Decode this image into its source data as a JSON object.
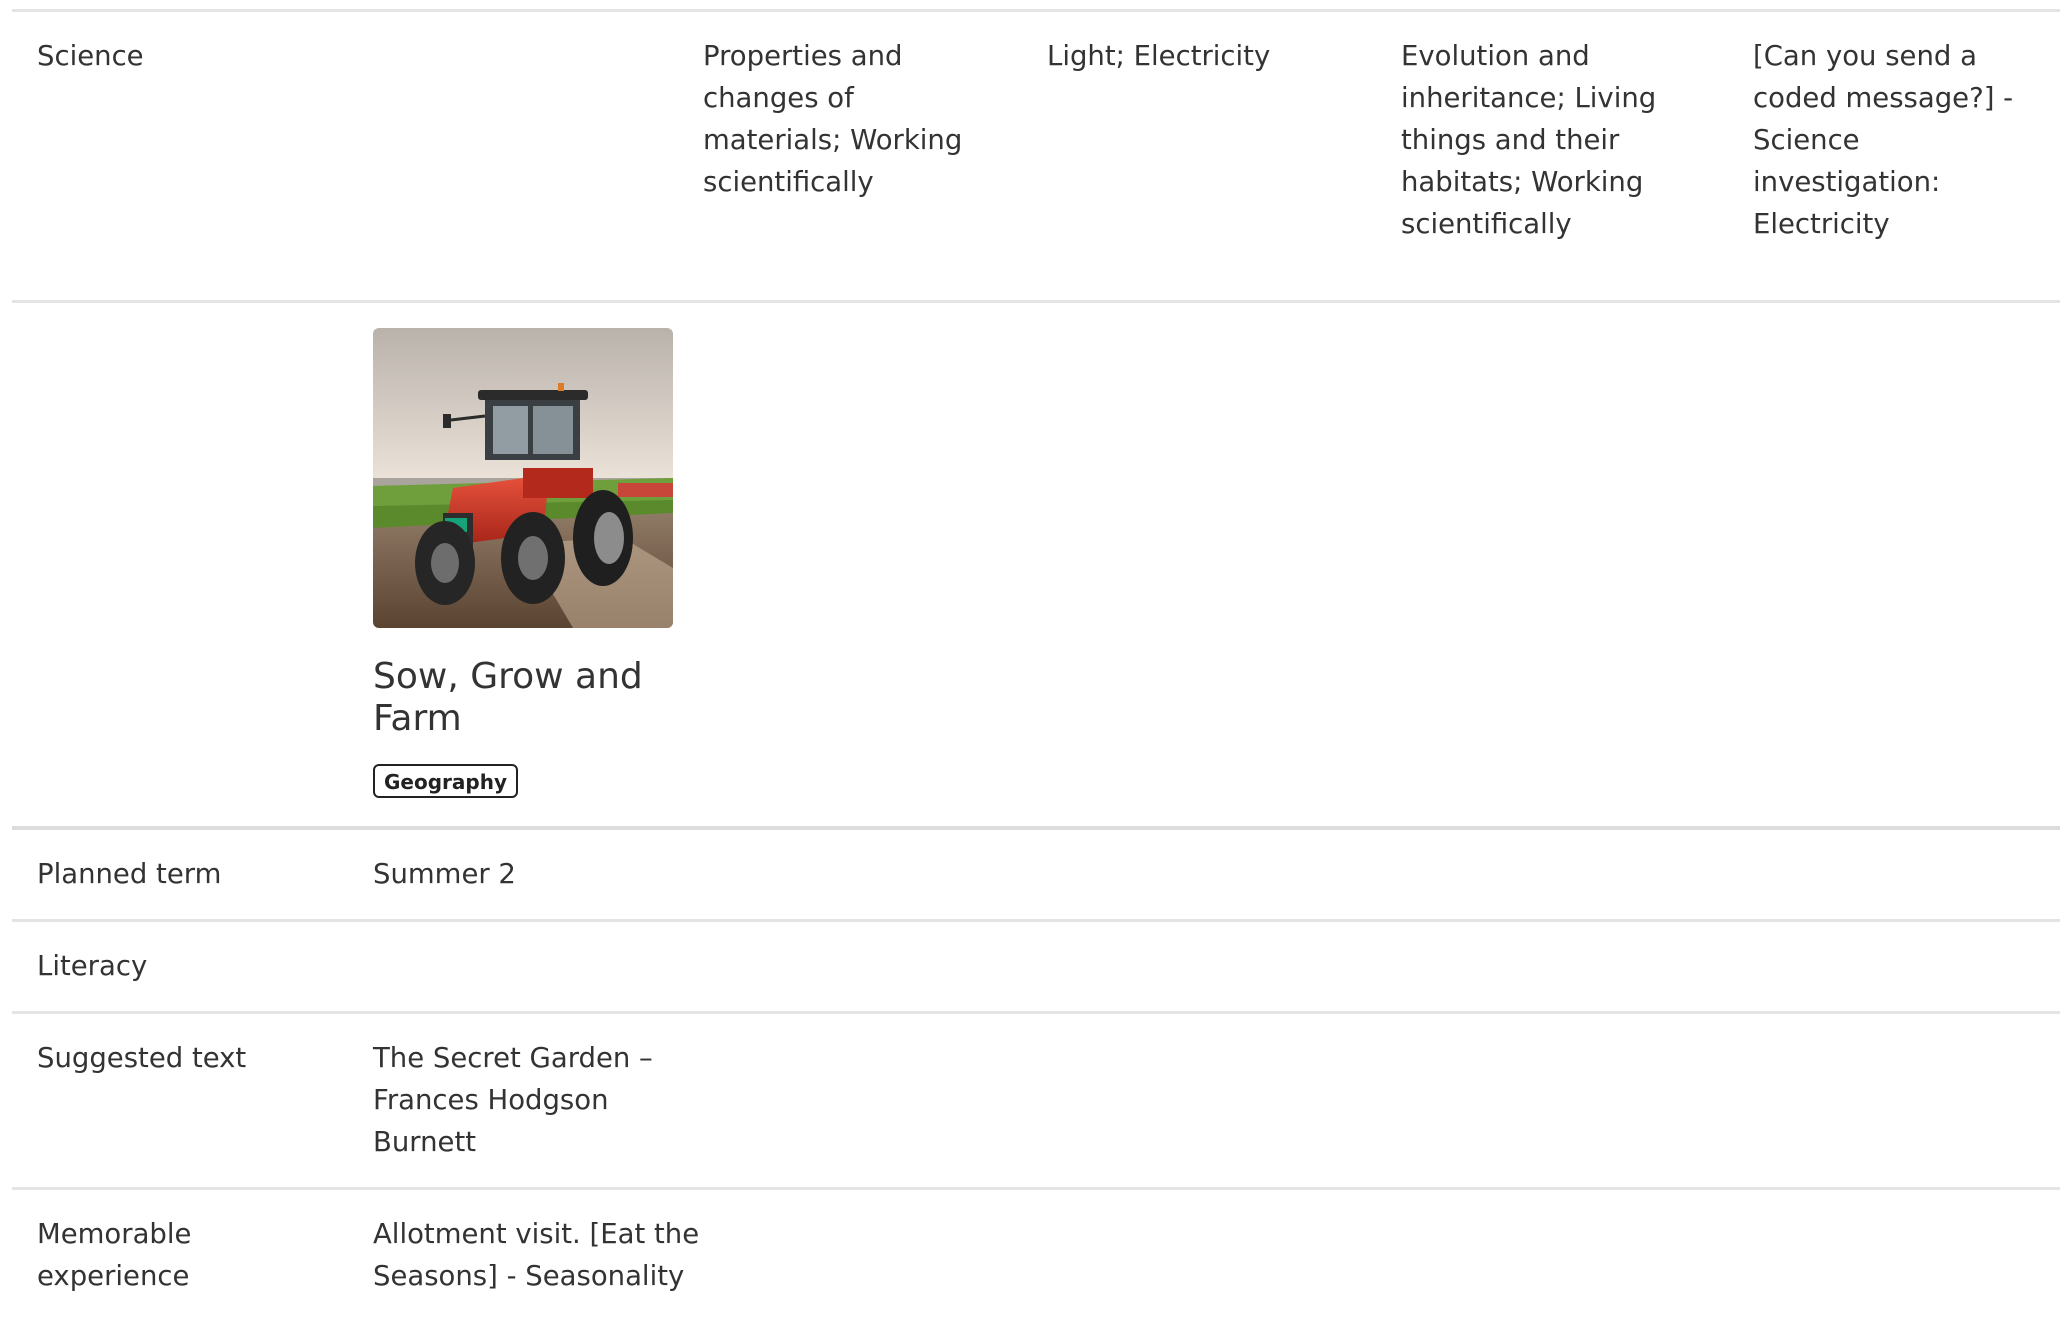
{
  "science": {
    "label": "Science",
    "cells": [
      "Properties and changes of materials; Working scientifically",
      "Light; Electricity",
      "Evolution and inheritance; Living things and their habitats; Working scientifically",
      "[Can you send a coded message?] - Science investigation: Electricity"
    ]
  },
  "topic": {
    "title": "Sow, Grow and Farm",
    "tag": "Geography",
    "image_icon": "tractor-photo"
  },
  "rows": {
    "planned_term": {
      "label": "Planned term",
      "value": "Summer 2"
    },
    "literacy": {
      "label": "Literacy",
      "value": ""
    },
    "suggested_text": {
      "label": "Suggested text",
      "value": "The Secret Garden – Frances Hodgson Burnett"
    },
    "memorable_experience": {
      "label": "Memorable experience",
      "value": "Allotment visit. [Eat the Seasons] - Seasonality"
    }
  },
  "colors": {
    "text": "#333333",
    "rule": "#e4e4e4",
    "tag_border": "#222222"
  }
}
